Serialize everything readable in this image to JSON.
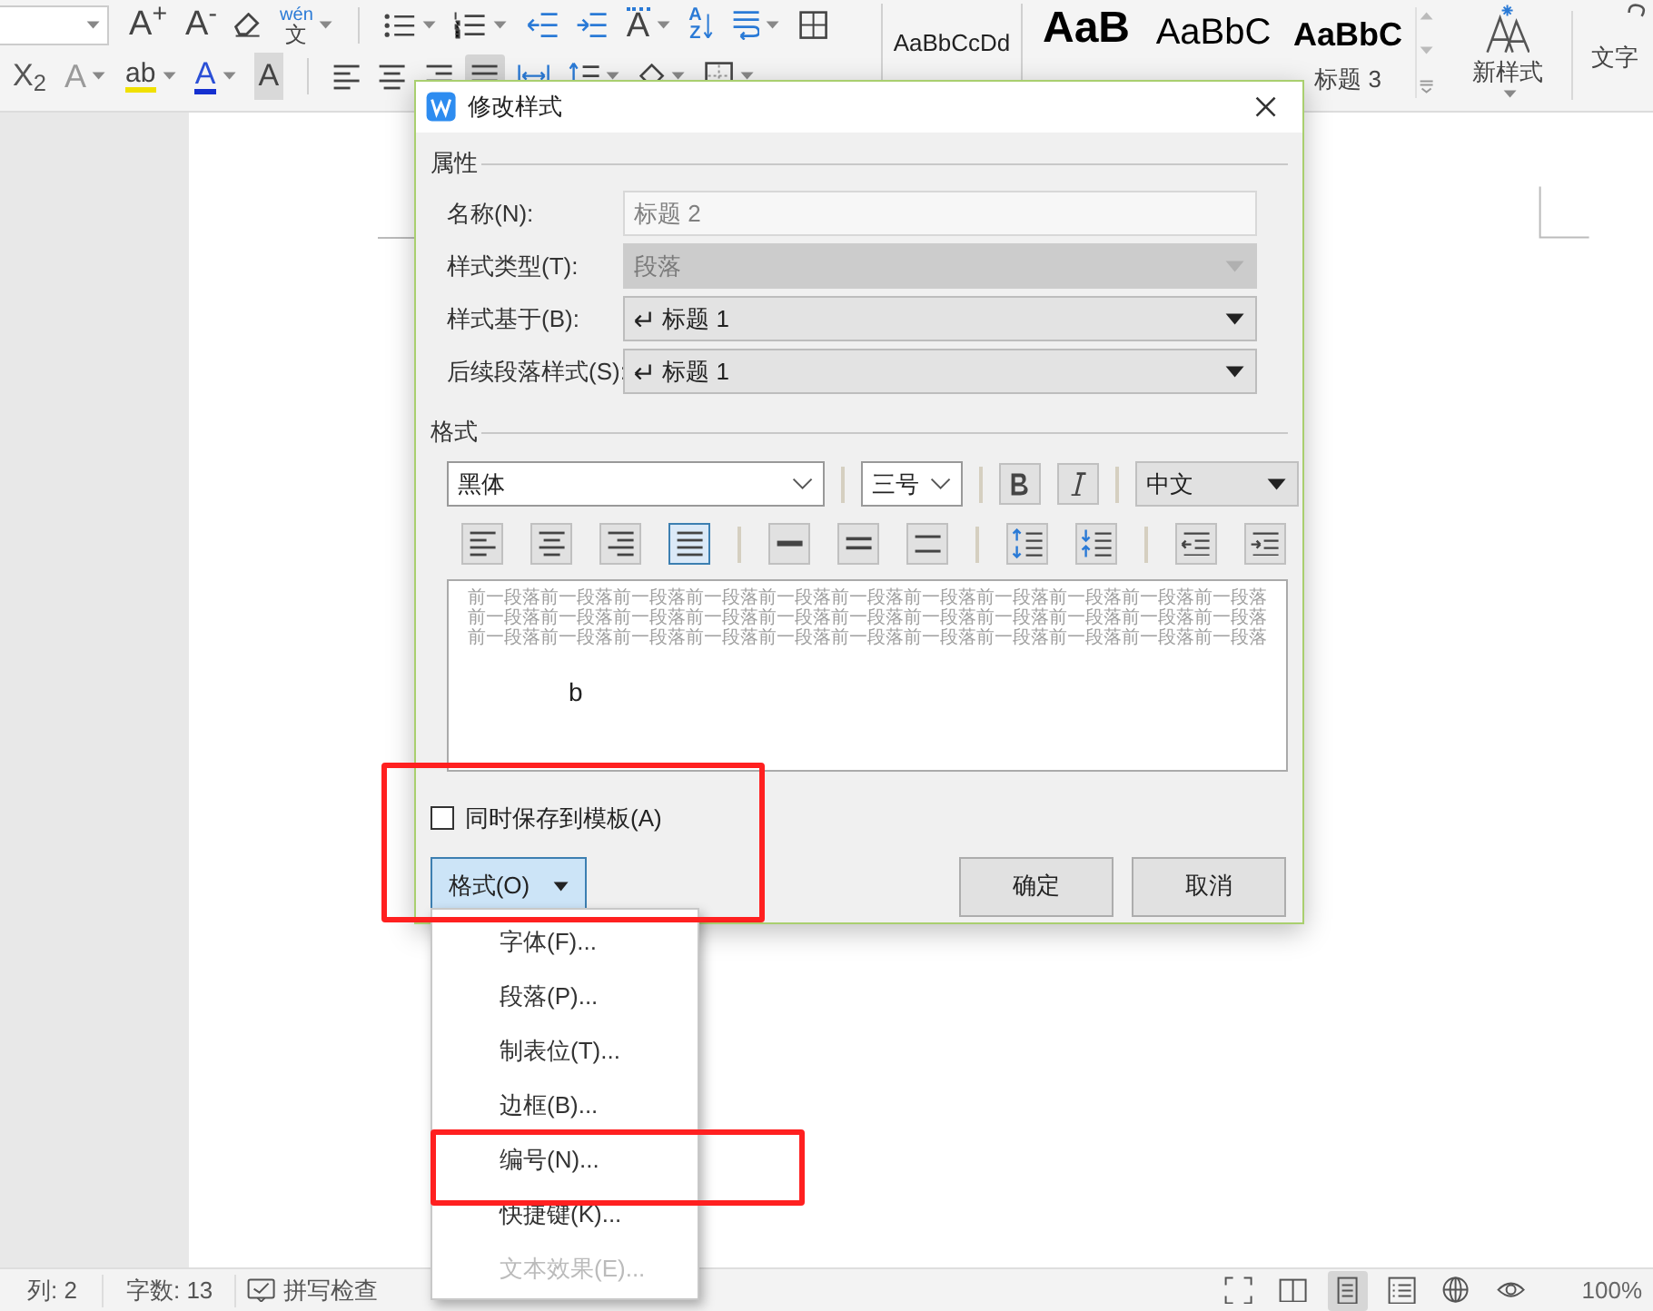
{
  "toolbar": {
    "row_1": [
      {
        "kind": "combo",
        "dropdown": true
      },
      {
        "kind": "grow",
        "text": "A$^{+}$",
        "dropdown": false
      },
      {
        "kind": "shrink",
        "text": "A$^{-}$",
        "dropdown": false
      },
      {
        "kind": "eraser",
        "dropdown": false
      },
      {
        "kind": "phonetic",
        "ruby": "wén",
        "text": "文",
        "dropdown": true
      },
      {
        "kind": "sep"
      },
      {
        "kind": "bullets",
        "dropdown": true
      },
      {
        "kind": "numbering",
        "dropdown": true
      },
      {
        "kind": "outdent",
        "dropdown": false
      },
      {
        "kind": "indent",
        "dropdown": false
      },
      {
        "kind": "char_spacing",
        "text": "A",
        "dropdown": true
      },
      {
        "kind": "sort",
        "text": "AZ",
        "dropdown": false
      },
      {
        "kind": "linebreak",
        "dropdown": true
      },
      {
        "kind": "table",
        "dropdown": false
      }
    ],
    "row_2": [
      {
        "kind": "subscript",
        "text": "X$_{2}$",
        "dropdown": false
      },
      {
        "kind": "outline",
        "text": "A",
        "dropdown": true
      },
      {
        "kind": "highlight",
        "text": "ab",
        "dropdown": true
      },
      {
        "kind": "font_color",
        "text": "A",
        "dropdown": true
      },
      {
        "kind": "shaded",
        "text": "A",
        "dropdown": false
      },
      {
        "kind": "sep"
      },
      {
        "kind": "align_left",
        "dropdown": false,
        "selected": false
      },
      {
        "kind": "align_center",
        "dropdown": false,
        "selected": false
      },
      {
        "kind": "align_right",
        "dropdown": false,
        "selected": false
      },
      {
        "kind": "justify",
        "dropdown": false,
        "selected": true
      },
      {
        "kind": "distribute",
        "dropdown": false,
        "selected": false
      },
      {
        "kind": "line_spacing",
        "dropdown": true
      },
      {
        "kind": "shading",
        "dropdown": true
      },
      {
        "kind": "border",
        "dropdown": true
      }
    ],
    "styles": [
      {
        "kind": "normal",
        "preview": "AaBbCcDd"
      },
      {
        "kind": "heading_1",
        "preview": "AaB"
      },
      {
        "kind": "heading_2",
        "preview": "AaBbC"
      },
      {
        "kind": "heading_3",
        "preview": "AaBbC",
        "label": "标题 3"
      }
    ],
    "new_style": "新样式",
    "text_tools": "文字"
  },
  "dialog": {
    "title": "修改样式",
    "properties_label": "属性",
    "fields": [
      {
        "kind": "text",
        "label": "名称(N):",
        "value": "标题 2",
        "disabled": true
      },
      {
        "kind": "select",
        "label": "样式类型(T):",
        "value": "段落",
        "disabled": true
      },
      {
        "kind": "select",
        "label": "样式基于(B):",
        "value": "标题 1",
        "disabled": false,
        "paragraph_mark": true
      },
      {
        "kind": "select",
        "label": "后续段落样式(S):",
        "value": "标题 1",
        "disabled": false,
        "paragraph_mark": true
      }
    ],
    "format_label": "格式",
    "font": "黑体",
    "size": "三号",
    "script": "中文",
    "paragraph_buttons": [
      {
        "kind": "align_left",
        "selected": false
      },
      {
        "kind": "align_center",
        "selected": false
      },
      {
        "kind": "align_right",
        "selected": false
      },
      {
        "kind": "justify",
        "selected": true
      },
      {
        "kind": "sep"
      },
      {
        "kind": "spacing_single",
        "selected": false
      },
      {
        "kind": "spacing_half",
        "selected": false
      },
      {
        "kind": "spacing_double",
        "selected": false
      },
      {
        "kind": "sep"
      },
      {
        "kind": "space_increase",
        "selected": false
      },
      {
        "kind": "space_decrease",
        "selected": false
      },
      {
        "kind": "sep"
      },
      {
        "kind": "indent_decrease",
        "selected": false
      },
      {
        "kind": "indent_increase",
        "selected": false
      }
    ],
    "preview_lines": [
      "前一段落前一段落前一段落前一段落前一段落前一段落前一段落前一段落前一段落前一段落前一段落",
      "前一段落前一段落前一段落前一段落前一段落前一段落前一段落前一段落前一段落前一段落前一段落",
      "前一段落前一段落前一段落前一段落前一段落前一段落前一段落前一段落前一段落前一段落前一段落"
    ],
    "preview_sample": "b",
    "save_to_template": {
      "label": "同时保存到模板(A)",
      "checked": false
    },
    "format_button": {
      "label": "格式(O)",
      "expanded": true
    },
    "buttons": [
      "确定",
      "取消"
    ]
  },
  "format_menu": [
    {
      "label": "字体(F)...",
      "disabled": false
    },
    {
      "label": "段落(P)...",
      "disabled": false
    },
    {
      "label": "制表位(T)...",
      "disabled": false
    },
    {
      "label": "边框(B)...",
      "disabled": false
    },
    {
      "label": "编号(N)...",
      "disabled": false
    },
    {
      "label": "快捷键(K)...",
      "disabled": false
    },
    {
      "label": "文本效果(E)...",
      "disabled": true
    }
  ],
  "status_bar": {
    "column": "列: 2",
    "word_count": "字数: 13",
    "spell_check": "拼写检查",
    "zoom": "100%",
    "views": [
      {
        "kind": "fullscreen",
        "selected": false
      },
      {
        "kind": "reading",
        "selected": false
      },
      {
        "kind": "page",
        "selected": true
      },
      {
        "kind": "outline",
        "selected": false
      },
      {
        "kind": "web",
        "selected": false
      },
      {
        "kind": "eye",
        "selected": false
      }
    ]
  }
}
